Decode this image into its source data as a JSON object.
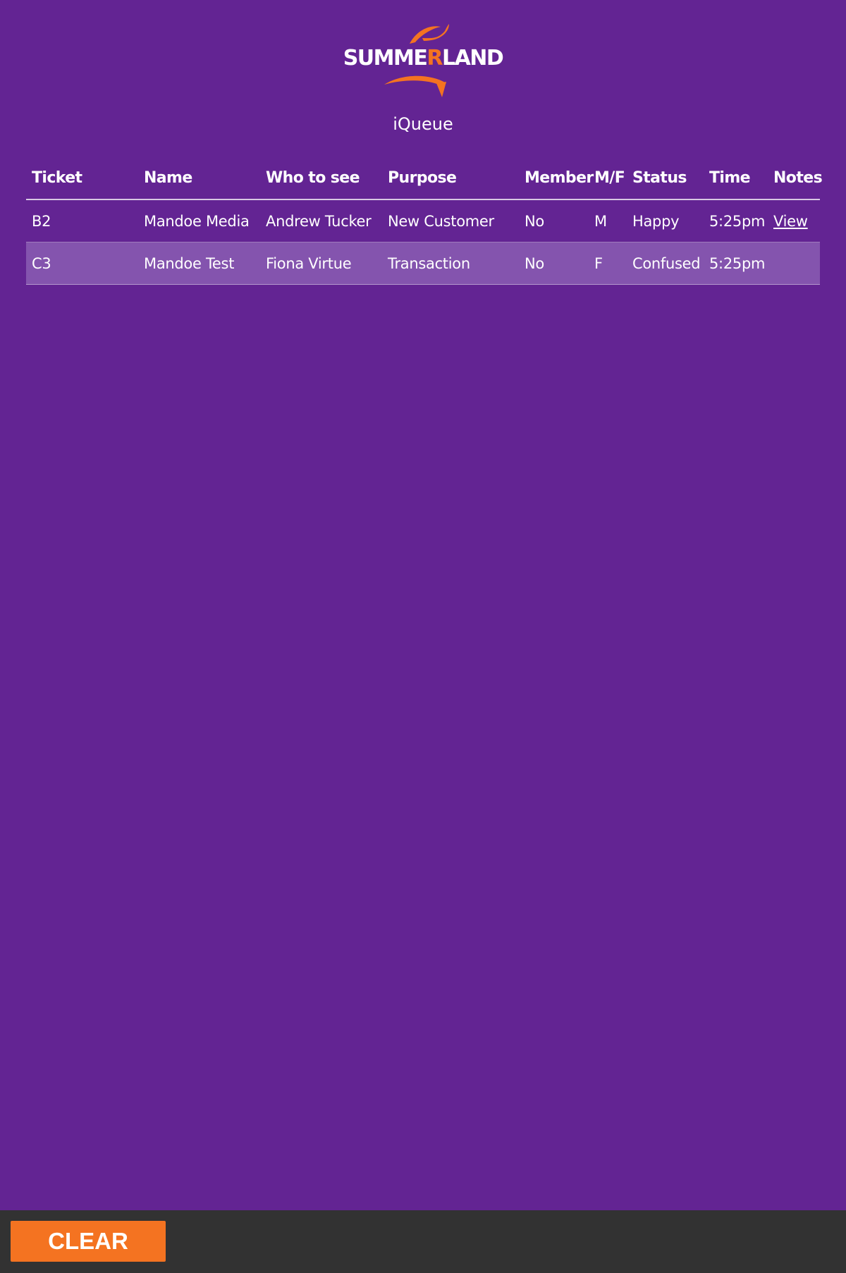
{
  "header": {
    "logo_text_1": "SUMME",
    "logo_text_2": "R",
    "logo_text_3": "LAND",
    "app_title": "iQueue"
  },
  "table": {
    "columns": [
      "Ticket",
      "Name",
      "Who to see",
      "Purpose",
      "Member",
      "M/F",
      "Status",
      "Time",
      "Notes"
    ],
    "rows": [
      [
        "B2",
        "Mandoe Media",
        "Andrew Tucker",
        "New Customer",
        "No",
        "M",
        "Happy",
        "5:25pm",
        "View"
      ],
      [
        "C3",
        "Mandoe Test",
        "Fiona Virtue",
        "Transaction",
        "No",
        "F",
        "Confused",
        "5:25pm",
        ""
      ]
    ]
  },
  "footer": {
    "clear_label": "CLEAR"
  },
  "colors": {
    "background": "#632493",
    "accent": "#f47321",
    "row_highlight": "#8454ae",
    "footer": "#323232"
  }
}
